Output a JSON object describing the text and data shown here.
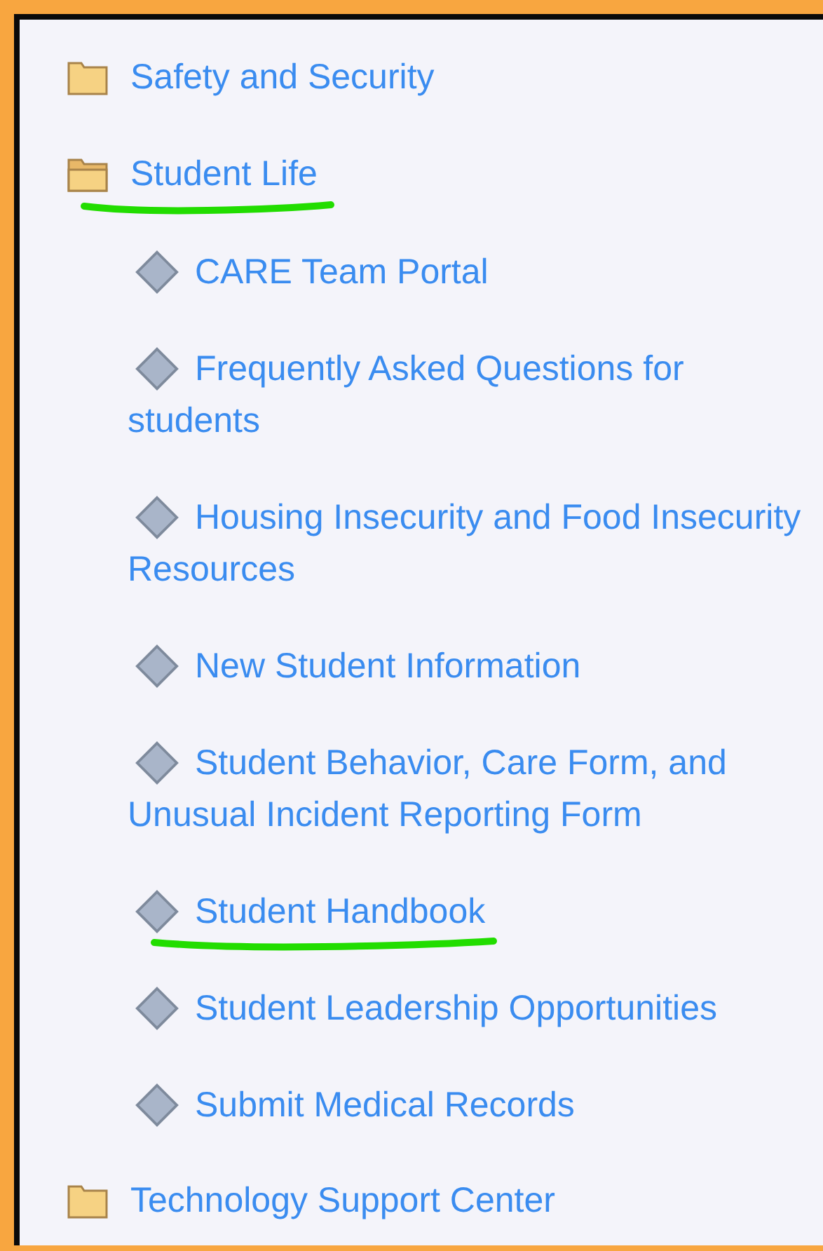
{
  "tree": [
    {
      "label": "Safety and Security",
      "expanded": false,
      "underlined": false
    },
    {
      "label": "Student Life",
      "expanded": true,
      "underlined": true,
      "children": [
        {
          "label": "CARE Team Portal",
          "underlined": false
        },
        {
          "label": "Frequently Asked Questions for students",
          "underlined": false
        },
        {
          "label": "Housing Insecurity and Food Insecurity Resources",
          "underlined": false
        },
        {
          "label": "New Student Information",
          "underlined": false
        },
        {
          "label": "Student Behavior, Care Form, and Unusual Incident Reporting Form",
          "underlined": false
        },
        {
          "label": "Student Handbook",
          "underlined": true
        },
        {
          "label": "Student Leadership Opportunities",
          "underlined": false
        },
        {
          "label": "Submit Medical Records",
          "underlined": false
        }
      ]
    },
    {
      "label": "Technology Support Center",
      "expanded": false,
      "underlined": false
    }
  ]
}
